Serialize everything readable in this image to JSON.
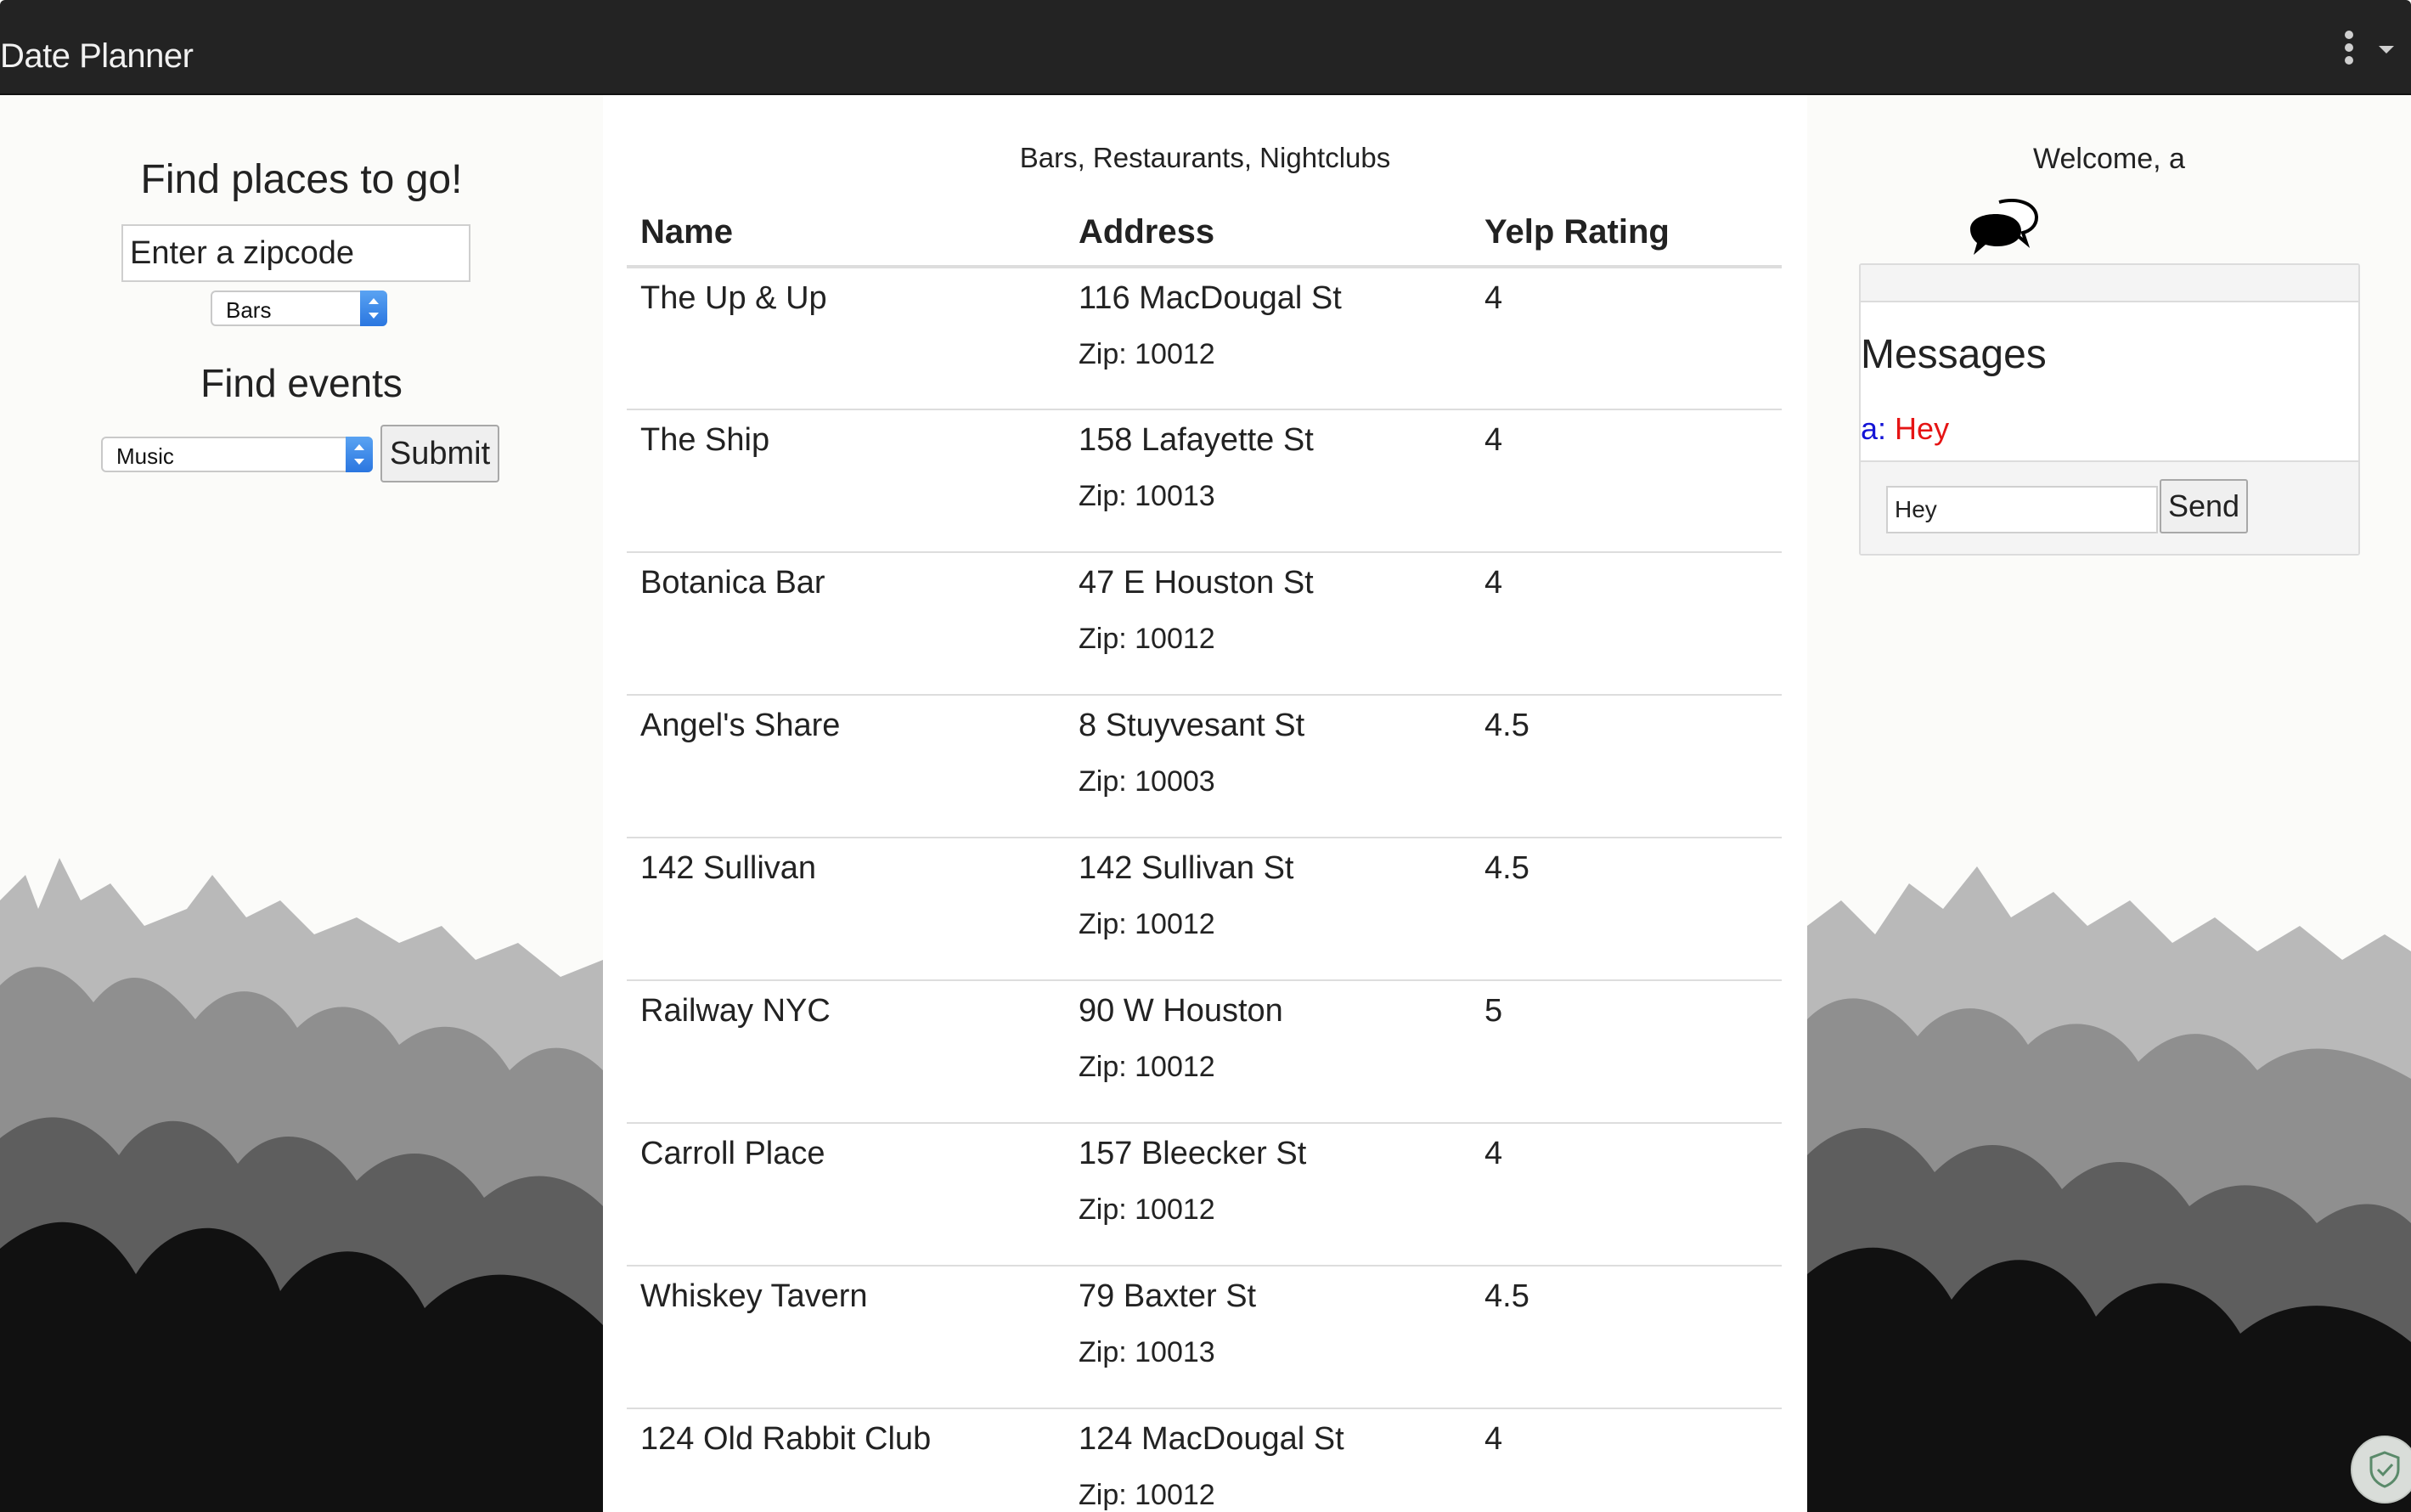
{
  "app": {
    "title": "Date Planner"
  },
  "header": {
    "menu_icon": "kebab-menu-icon",
    "dropdown_icon": "caret-down-icon"
  },
  "search": {
    "heading": "Find places to go!",
    "zip_placeholder": "Enter a zipcode",
    "place_type": "Bars",
    "events_heading": "Find events",
    "event_type": "Music",
    "submit_label": "Submit"
  },
  "results": {
    "category_title": "Bars, Restaurants, Nightclubs",
    "columns": [
      "Name",
      "Address",
      "Yelp Rating"
    ],
    "zip_prefix": "Zip: ",
    "rows": [
      {
        "name": "The Up & Up",
        "address": "116 MacDougal St",
        "zip": "10012",
        "rating": "4"
      },
      {
        "name": "The Ship",
        "address": "158 Lafayette St",
        "zip": "10013",
        "rating": "4"
      },
      {
        "name": "Botanica Bar",
        "address": "47 E Houston St",
        "zip": "10012",
        "rating": "4"
      },
      {
        "name": "Angel's Share",
        "address": "8 Stuyvesant St",
        "zip": "10003",
        "rating": "4.5"
      },
      {
        "name": "142 Sullivan",
        "address": "142 Sullivan St",
        "zip": "10012",
        "rating": "4.5"
      },
      {
        "name": "Railway NYC",
        "address": "90 W Houston",
        "zip": "10012",
        "rating": "5"
      },
      {
        "name": "Carroll Place",
        "address": "157 Bleecker St",
        "zip": "10012",
        "rating": "4"
      },
      {
        "name": "Whiskey Tavern",
        "address": "79 Baxter St",
        "zip": "10013",
        "rating": "4.5"
      },
      {
        "name": "124 Old Rabbit Club",
        "address": "124 MacDougal St",
        "zip": "10012",
        "rating": "4"
      }
    ]
  },
  "user": {
    "welcome": "Welcome, a"
  },
  "chat": {
    "icon": "chat-bubbles-icon",
    "title": "Messages",
    "messages": [
      {
        "user": "a",
        "text": "Hey"
      }
    ],
    "input_value": "Hey",
    "send_label": "Send"
  },
  "extension_badge": {
    "icon": "shield-check-icon"
  }
}
